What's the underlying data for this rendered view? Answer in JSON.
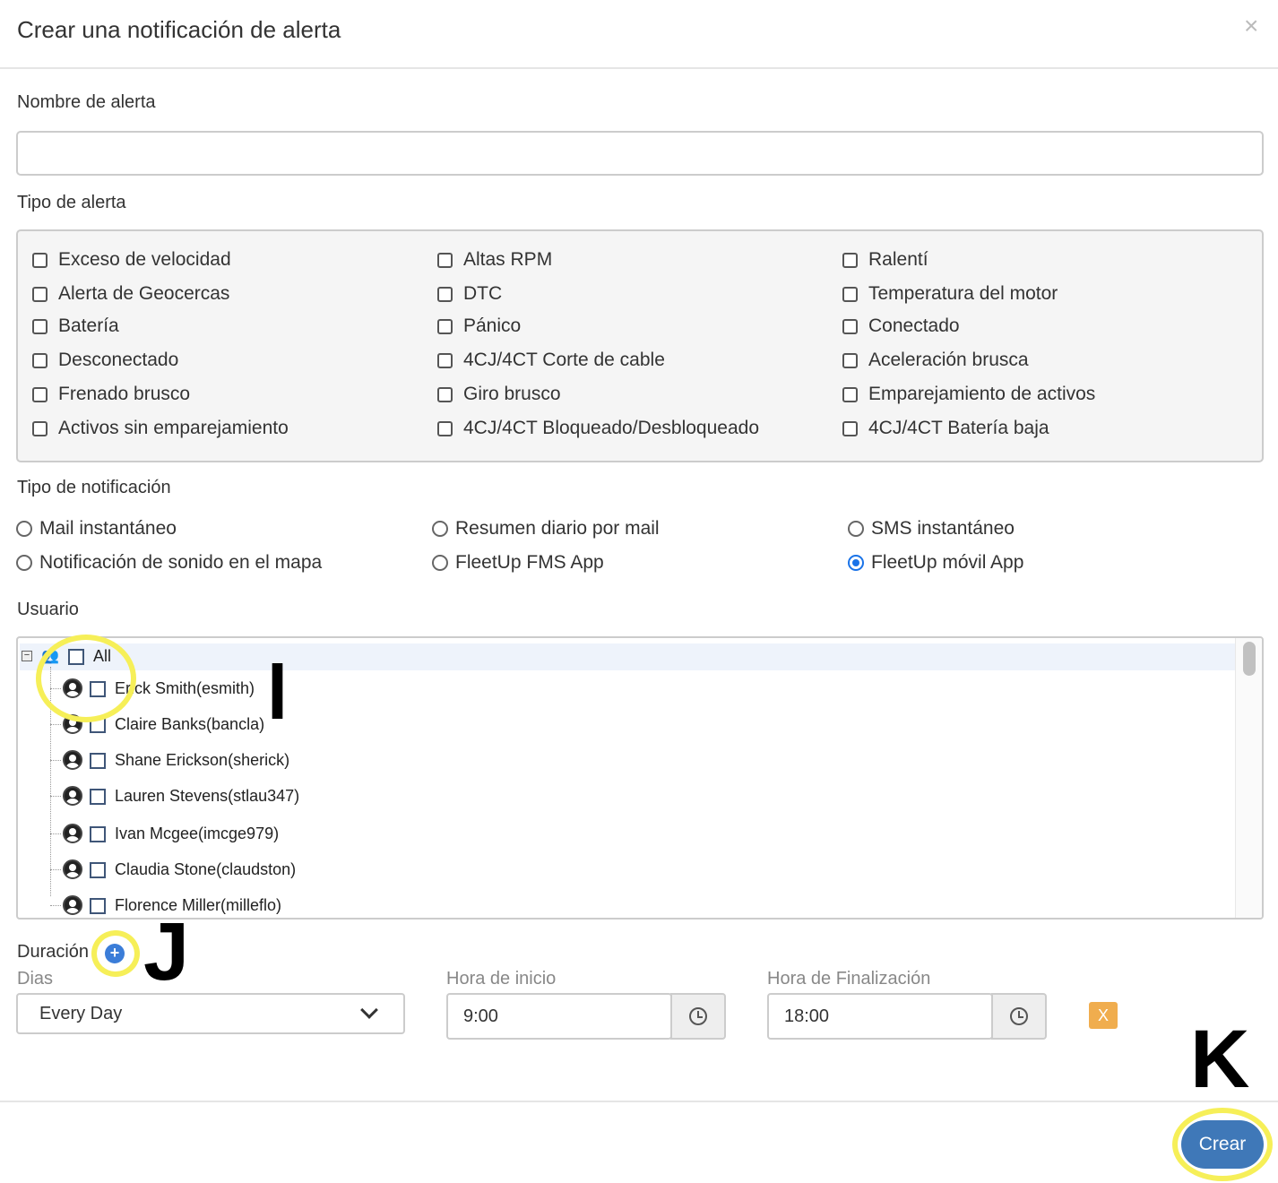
{
  "header": {
    "title": "Crear una notificación de alerta",
    "close": "×"
  },
  "alert_name": {
    "label": "Nombre de alerta",
    "value": ""
  },
  "alert_type": {
    "label": "Tipo de alerta",
    "options": [
      "Exceso de velocidad",
      "Altas RPM",
      "Ralentí",
      "Alerta de Geocercas",
      "DTC",
      "Temperatura del motor",
      "Batería",
      "Pánico",
      "Conectado",
      "Desconectado",
      "4CJ/4CT Corte de cable",
      "Aceleración brusca",
      "Frenado brusco",
      "Giro brusco",
      "Emparejamiento de activos",
      "Activos sin emparejamiento",
      "4CJ/4CT Bloqueado/Desbloqueado",
      "4CJ/4CT Batería baja"
    ]
  },
  "notification_type": {
    "label": "Tipo de notificación",
    "options": [
      "Mail instantáneo",
      "Resumen diario por mail",
      "SMS instantáneo",
      "Notificación de sonido en el mapa",
      "FleetUp FMS App",
      "FleetUp móvil App"
    ],
    "selected": "FleetUp móvil App"
  },
  "users": {
    "label": "Usuario",
    "all_label": "All",
    "items": [
      "Erick Smith(esmith)",
      "Claire Banks(bancla)",
      "Shane Erickson(sherick)",
      "Lauren Stevens(stlau347)",
      "Ivan Mcgee(imcge979)",
      "Claudia Stone(claudston)",
      "Florence Miller(milleflo)"
    ]
  },
  "duration": {
    "label": "Duración",
    "days_label": "Dias",
    "days_value": "Every Day",
    "start_label": "Hora de inicio",
    "start_value": "9:00",
    "end_label": "Hora de Finalización",
    "end_value": "18:00",
    "remove_label": "X"
  },
  "footer": {
    "create_label": "Crear"
  },
  "annotations": {
    "i": "I",
    "j": "J",
    "k": "K",
    "ring_color": "#f6ef58"
  },
  "colors": {
    "primary": "#3f78b8",
    "warning": "#f0ad4e",
    "radio_selected": "#1a73e8"
  }
}
